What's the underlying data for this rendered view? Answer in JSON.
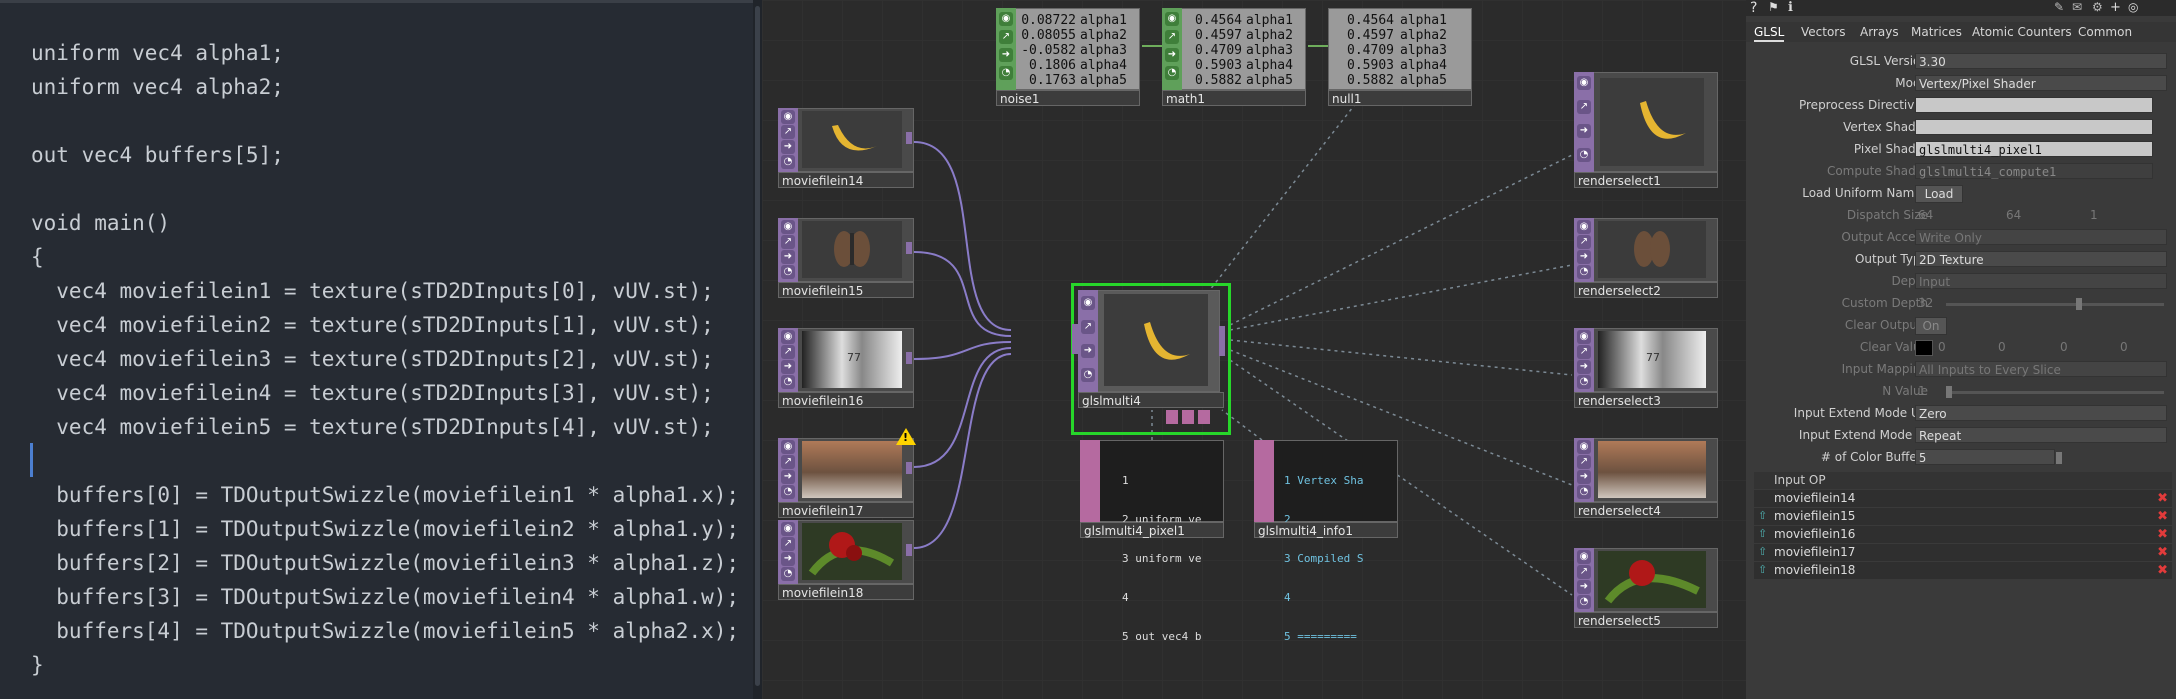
{
  "editor": {
    "lines": [
      {
        "text": "uniform vec4 alpha1;"
      },
      {
        "text": "uniform vec4 alpha2;"
      },
      {
        "text": ""
      },
      {
        "text": "out vec4 buffers[5];"
      },
      {
        "text": ""
      },
      {
        "text": "void main()"
      },
      {
        "text": "{"
      },
      {
        "text": "  vec4 moviefilein1 = texture(sTD2DInputs[0], vUV.st);"
      },
      {
        "text": "  vec4 moviefilein2 = texture(sTD2DInputs[1], vUV.st);"
      },
      {
        "text": "  vec4 moviefilein3 = texture(sTD2DInputs[2], vUV.st);"
      },
      {
        "text": "  vec4 moviefilein4 = texture(sTD2DInputs[3], vUV.st);"
      },
      {
        "text": "  vec4 moviefilein5 = texture(sTD2DInputs[4], vUV.st);"
      },
      {
        "text": ""
      },
      {
        "text": "  buffers[0] = TDOutputSwizzle(moviefilein1 * alpha1.x);"
      },
      {
        "text": "  buffers[1] = TDOutputSwizzle(moviefilein2 * alpha1.y);"
      },
      {
        "text": "  buffers[2] = TDOutputSwizzle(moviefilein3 * alpha1.z);"
      },
      {
        "text": "  buffers[3] = TDOutputSwizzle(moviefilein4 * alpha1.w);"
      },
      {
        "text": "  buffers[4] = TDOutputSwizzle(moviefilein5 * alpha2.x);"
      },
      {
        "text": "}"
      }
    ]
  },
  "network": {
    "chops": {
      "noise1": {
        "label": "noise1",
        "values": "0.08722\n0.08055\n-0.0582\n0.1806\n0.1763",
        "names": "alpha1\nalpha2\nalpha3\nalpha4\nalpha5"
      },
      "math1": {
        "label": "math1",
        "values": "0.4564\n0.4597\n0.4709\n0.5903\n0.5882",
        "names": "alpha1\nalpha2\nalpha3\nalpha4\nalpha5"
      },
      "null1": {
        "label": "null1",
        "values": "0.4564\n0.4597\n0.4709\n0.5903\n0.5882",
        "names": "alpha1\nalpha2\nalpha3\nalpha4\nalpha5"
      }
    },
    "inputs": [
      "moviefilein14",
      "moviefilein15",
      "moviefilein16",
      "moviefilein17",
      "moviefilein18"
    ],
    "main": "glslmulti4",
    "pixel_dat": {
      "label": "glslmulti4_pixel1",
      "lines": [
        "1",
        "2 uniform ve",
        "3 uniform ve",
        "4",
        "5 out vec4 b"
      ]
    },
    "info_dat": {
      "label": "glslmulti4_info1",
      "lines": [
        "1 Vertex Sha",
        "2",
        "3 Compiled S",
        "4",
        "5 ========="
      ]
    },
    "outputs": [
      "renderselect1",
      "renderselect2",
      "renderselect3",
      "renderselect4",
      "renderselect5"
    ],
    "warning_glyph": "!",
    "placeholder_text": "77"
  },
  "params": {
    "tabs": [
      "GLSL",
      "Vectors",
      "Arrays",
      "Matrices",
      "Atomic Counters",
      "Common"
    ],
    "rows": {
      "glsl_version": {
        "label": "GLSL Version",
        "value": "3.30"
      },
      "mode": {
        "label": "Mode",
        "value": "Vertex/Pixel Shader"
      },
      "preprocess": {
        "label": "Preprocess Directives",
        "value": ""
      },
      "vertex_shader": {
        "label": "Vertex Shader",
        "value": ""
      },
      "pixel_shader": {
        "label": "Pixel Shader",
        "value": "glslmulti4_pixel1"
      },
      "compute_shader": {
        "label": "Compute Shader",
        "value": "glslmulti4_compute1"
      },
      "load_uniform": {
        "label": "Load Uniform Names",
        "button": "Load"
      },
      "dispatch": {
        "label": "Dispatch Size",
        "v1": "64",
        "v2": "64",
        "v3": "1"
      },
      "output_access": {
        "label": "Output Access",
        "value": "Write Only"
      },
      "output_type": {
        "label": "Output Type",
        "value": "2D Texture"
      },
      "depth": {
        "label": "Depth",
        "value": "Input"
      },
      "custom_depth": {
        "label": "Custom Depth",
        "value": "32"
      },
      "clear_outputs": {
        "label": "Clear Outputs",
        "button": "On"
      },
      "clear_value": {
        "label": "Clear Value",
        "v1": "0",
        "v2": "0",
        "v3": "0",
        "v4": "0"
      },
      "input_mapping": {
        "label": "Input Mapping",
        "value": "All Inputs to Every Slice"
      },
      "n_value": {
        "label": "N Value",
        "value": "1"
      },
      "extend_uv": {
        "label": "Input Extend Mode UV",
        "value": "Zero"
      },
      "extend_w": {
        "label": "Input Extend Mode W",
        "value": "Repeat"
      },
      "color_buffers": {
        "label": "# of Color Buffers",
        "value": "5"
      }
    },
    "input_header": "Input OP",
    "input_ops": [
      "moviefilein14",
      "moviefilein15",
      "moviefilein16",
      "moviefilein17",
      "moviefilein18"
    ],
    "glyphs": {
      "up": "⇧",
      "remove": "✖"
    }
  }
}
